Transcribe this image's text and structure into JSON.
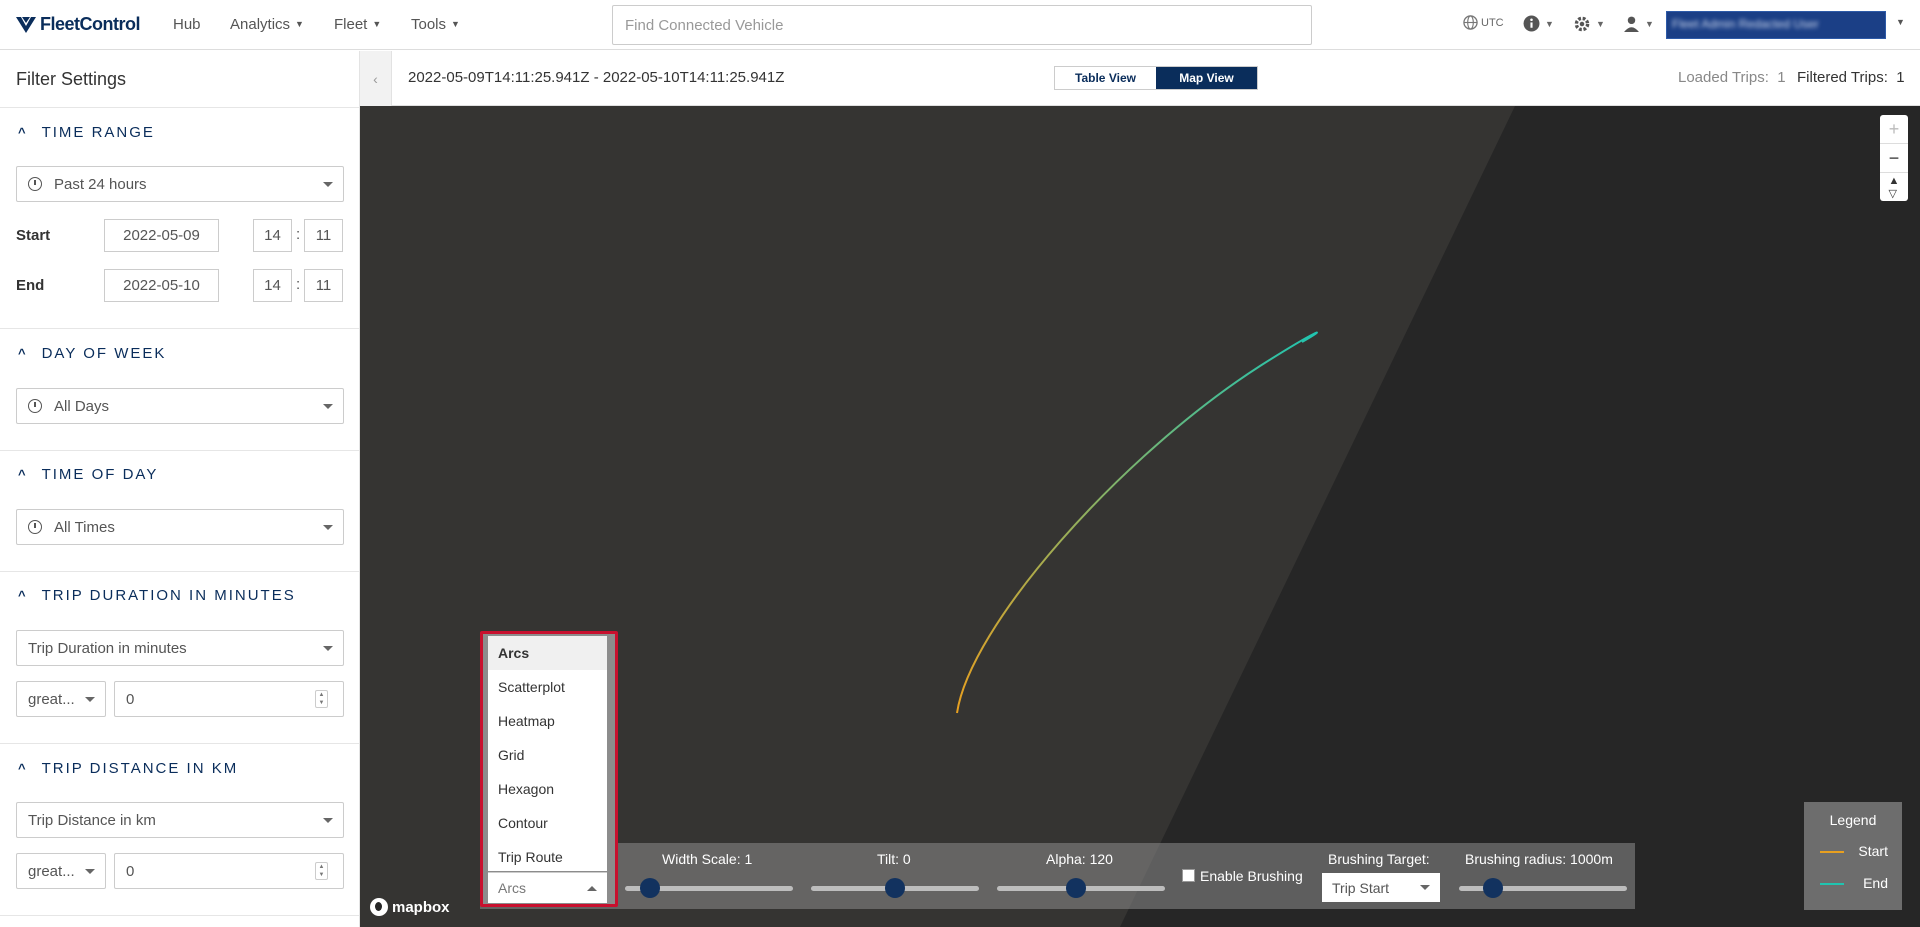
{
  "nav": {
    "brand": "FleetControl",
    "items": [
      {
        "label": "Hub",
        "caret": false
      },
      {
        "label": "Analytics",
        "caret": true
      },
      {
        "label": "Fleet",
        "caret": true
      },
      {
        "label": "Tools",
        "caret": true
      }
    ],
    "search_placeholder": "Find Connected Vehicle",
    "timezone": "UTC",
    "user_name": "Fleet Admin Redacted User"
  },
  "sidebar": {
    "title": "Filter Settings",
    "time_range": {
      "heading": "TIME RANGE",
      "preset": "Past 24 hours",
      "start_label": "Start",
      "start_date": "2022-05-09",
      "start_hour": "14",
      "start_min": "11",
      "end_label": "End",
      "end_date": "2022-05-10",
      "end_hour": "14",
      "end_min": "11"
    },
    "day_of_week": {
      "heading": "DAY OF WEEK",
      "value": "All Days"
    },
    "time_of_day": {
      "heading": "TIME OF DAY",
      "value": "All Times"
    },
    "trip_duration": {
      "heading": "TRIP DURATION IN MINUTES",
      "select": "Trip Duration in minutes",
      "operator": "great...",
      "value": "0"
    },
    "trip_distance": {
      "heading": "TRIP DISTANCE IN KM",
      "select": "Trip Distance in km",
      "operator": "great...",
      "value": "0"
    }
  },
  "header": {
    "date_range": "2022-05-09T14:11:25.941Z - 2022-05-10T14:11:25.941Z",
    "table_view": "Table View",
    "map_view": "Map View",
    "active_view": "Map View",
    "loaded_label": "Loaded Trips:",
    "loaded_count": "1",
    "filtered_label": "Filtered Trips:",
    "filtered_count": "1"
  },
  "map": {
    "attribution": "mapbox",
    "arc_start_color": "#e8a020",
    "arc_end_color": "#20c4b0"
  },
  "controls": {
    "layer_options": [
      "Arcs",
      "Scatterplot",
      "Heatmap",
      "Grid",
      "Hexagon",
      "Contour",
      "Trip Route"
    ],
    "layer_selected": "Arcs",
    "width_scale_label": "Width Scale: 1",
    "width_scale_level": 0.15,
    "tilt_label": "Tilt: 0",
    "tilt_level": 0.5,
    "alpha_label": "Alpha: 120",
    "alpha_level": 0.47,
    "enable_brushing_label": "Enable Brushing",
    "enable_brushing": false,
    "brushing_target_label": "Brushing Target:",
    "brushing_target": "Trip Start",
    "brushing_radius_label": "Brushing radius: 1000m",
    "brushing_radius_level": 0.2
  },
  "legend": {
    "title": "Legend",
    "items": [
      {
        "label": "Start",
        "color": "#e8a020"
      },
      {
        "label": "End",
        "color": "#20c4b0"
      }
    ]
  }
}
